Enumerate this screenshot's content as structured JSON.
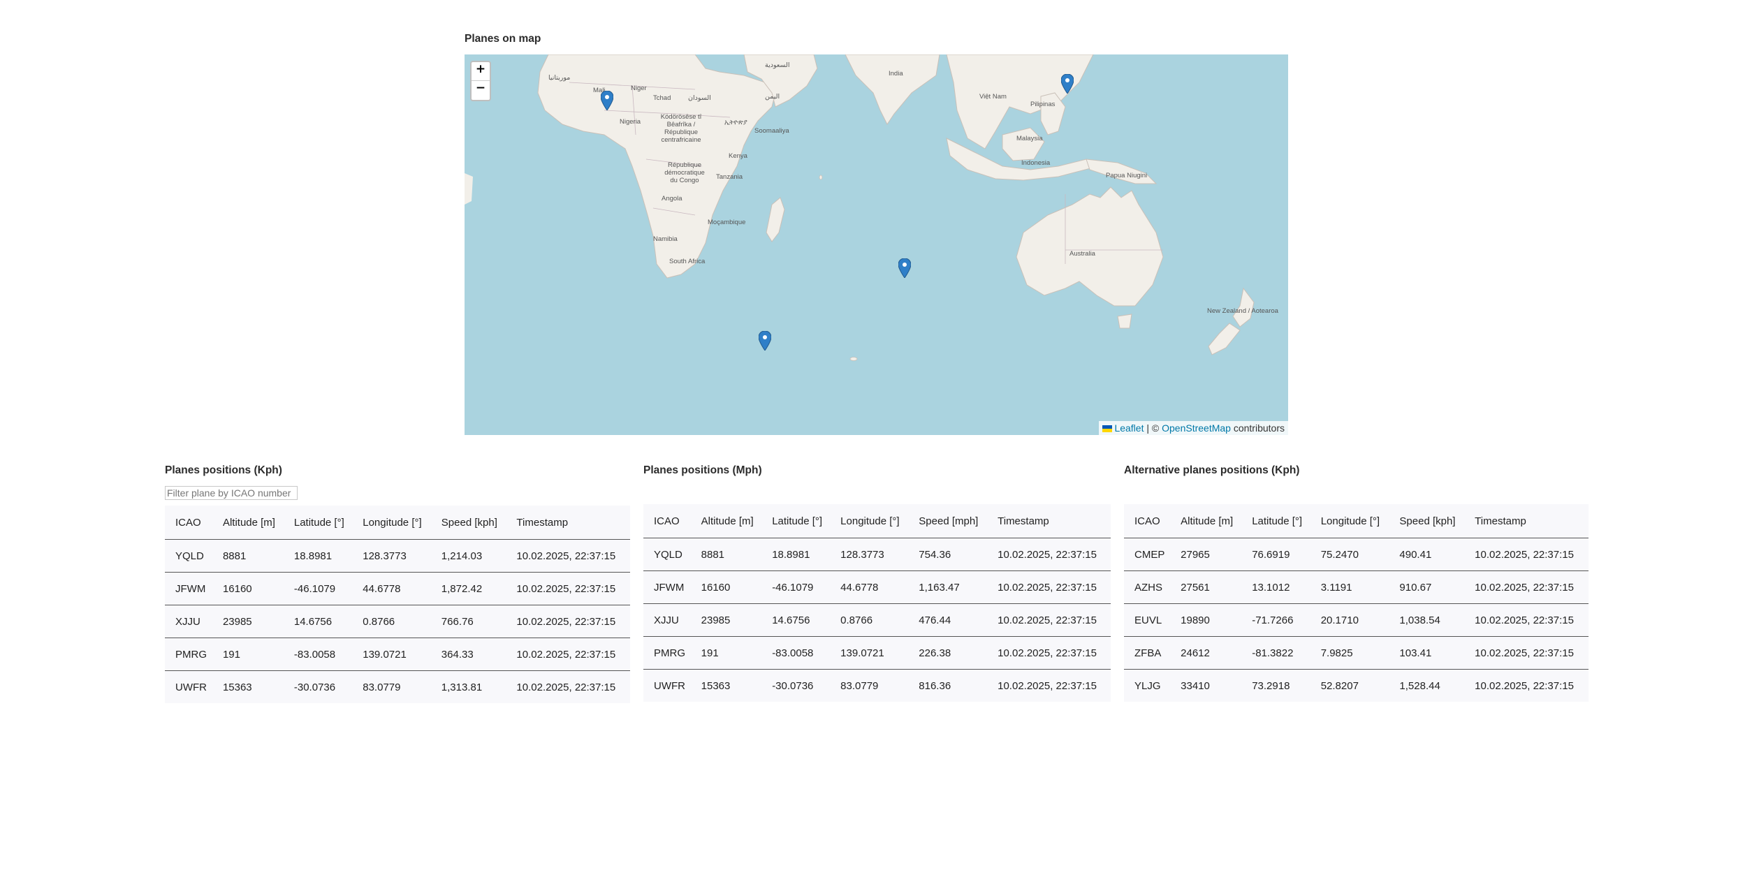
{
  "map_section": {
    "title": "Planes on map",
    "zoom_in": "+",
    "zoom_out": "−",
    "attribution": {
      "leaflet": "Leaflet",
      "separator": "| ©",
      "osm": "OpenStreetMap",
      "suffix": "contributors"
    },
    "labels": [
      "India",
      "Niger",
      "Mali",
      "Tchad",
      "Nigeria",
      "Kenya",
      "Tanzania",
      "Angola",
      "Namibia",
      "South Africa",
      "Moçambique",
      "Australia",
      "Indonesia",
      "Malaysia",
      "Papua Niugini",
      "Pilipinas",
      "Việt Nam",
      "New Zealand / Aotearoa",
      "République démocratique du Congo",
      "Soomaaliya",
      "Ködörösêse tî Bêafrîka / République centrafricaine",
      "السودان",
      "اليمن",
      "ኢትዮጵያ",
      "موريتانيا",
      "السعودية"
    ]
  },
  "table_kph": {
    "title": "Planes positions (Kph)",
    "filter_placeholder": "Filter plane by ICAO number",
    "headers": [
      "ICAO",
      "Altitude [m]",
      "Latitude [°]",
      "Longitude [°]",
      "Speed [kph]",
      "Timestamp"
    ],
    "rows": [
      [
        "YQLD",
        "8881",
        "18.8981",
        "128.3773",
        "1,214.03",
        "10.02.2025, 22:37:15"
      ],
      [
        "JFWM",
        "16160",
        "-46.1079",
        "44.6778",
        "1,872.42",
        "10.02.2025, 22:37:15"
      ],
      [
        "XJJU",
        "23985",
        "14.6756",
        "0.8766",
        "766.76",
        "10.02.2025, 22:37:15"
      ],
      [
        "PMRG",
        "191",
        "-83.0058",
        "139.0721",
        "364.33",
        "10.02.2025, 22:37:15"
      ],
      [
        "UWFR",
        "15363",
        "-30.0736",
        "83.0779",
        "1,313.81",
        "10.02.2025, 22:37:15"
      ]
    ]
  },
  "table_mph": {
    "title": "Planes positions (Mph)",
    "headers": [
      "ICAO",
      "Altitude [m]",
      "Latitude [°]",
      "Longitude [°]",
      "Speed [mph]",
      "Timestamp"
    ],
    "rows": [
      [
        "YQLD",
        "8881",
        "18.8981",
        "128.3773",
        "754.36",
        "10.02.2025, 22:37:15"
      ],
      [
        "JFWM",
        "16160",
        "-46.1079",
        "44.6778",
        "1,163.47",
        "10.02.2025, 22:37:15"
      ],
      [
        "XJJU",
        "23985",
        "14.6756",
        "0.8766",
        "476.44",
        "10.02.2025, 22:37:15"
      ],
      [
        "PMRG",
        "191",
        "-83.0058",
        "139.0721",
        "226.38",
        "10.02.2025, 22:37:15"
      ],
      [
        "UWFR",
        "15363",
        "-30.0736",
        "83.0779",
        "816.36",
        "10.02.2025, 22:37:15"
      ]
    ]
  },
  "table_alt": {
    "title": "Alternative planes positions (Kph)",
    "headers": [
      "ICAO",
      "Altitude [m]",
      "Latitude [°]",
      "Longitude [°]",
      "Speed [kph]",
      "Timestamp"
    ],
    "rows": [
      [
        "CMEP",
        "27965",
        "76.6919",
        "75.2470",
        "490.41",
        "10.02.2025, 22:37:15"
      ],
      [
        "AZHS",
        "27561",
        "13.1012",
        "3.1191",
        "910.67",
        "10.02.2025, 22:37:15"
      ],
      [
        "EUVL",
        "19890",
        "-71.7266",
        "20.1710",
        "1,038.54",
        "10.02.2025, 22:37:15"
      ],
      [
        "ZFBA",
        "24612",
        "-81.3822",
        "7.9825",
        "103.41",
        "10.02.2025, 22:37:15"
      ],
      [
        "YLJG",
        "33410",
        "73.2918",
        "52.8207",
        "1,528.44",
        "10.02.2025, 22:37:15"
      ]
    ]
  },
  "colors": {
    "water": "#aad3df",
    "land": "#f2efe9",
    "marker": "#2f7fc8",
    "link": "#0078a8"
  }
}
